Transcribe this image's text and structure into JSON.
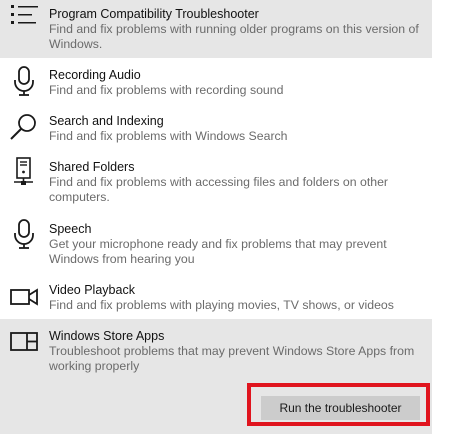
{
  "troubleshooters": [
    {
      "title": "Program Compatibility Troubleshooter",
      "description": "Find and fix problems with running older programs on this version of Windows.",
      "icon": "list-icon"
    },
    {
      "title": "Recording Audio",
      "description": "Find and fix problems with recording sound",
      "icon": "microphone-icon"
    },
    {
      "title": "Search and Indexing",
      "description": "Find and fix problems with Windows Search",
      "icon": "magnifier-icon"
    },
    {
      "title": "Shared Folders",
      "description": "Find and fix problems with accessing files and folders on other computers.",
      "icon": "networked-computer-icon"
    },
    {
      "title": "Speech",
      "description": "Get your microphone ready and fix problems that may prevent Windows from hearing you",
      "icon": "microphone-icon"
    },
    {
      "title": "Video Playback",
      "description": "Find and fix problems with playing movies, TV shows, or videos",
      "icon": "video-camera-icon"
    },
    {
      "title": "Windows Store Apps",
      "description": "Troubleshoot problems that may prevent Windows Store Apps from working properly",
      "icon": "store-apps-icon"
    }
  ],
  "run_button": {
    "label": "Run the troubleshooter"
  },
  "colors": {
    "selected_background": "#e6e6e6",
    "button_background": "#cccccc",
    "highlight_border": "#e0141e",
    "description_text": "#6b6b6b"
  }
}
